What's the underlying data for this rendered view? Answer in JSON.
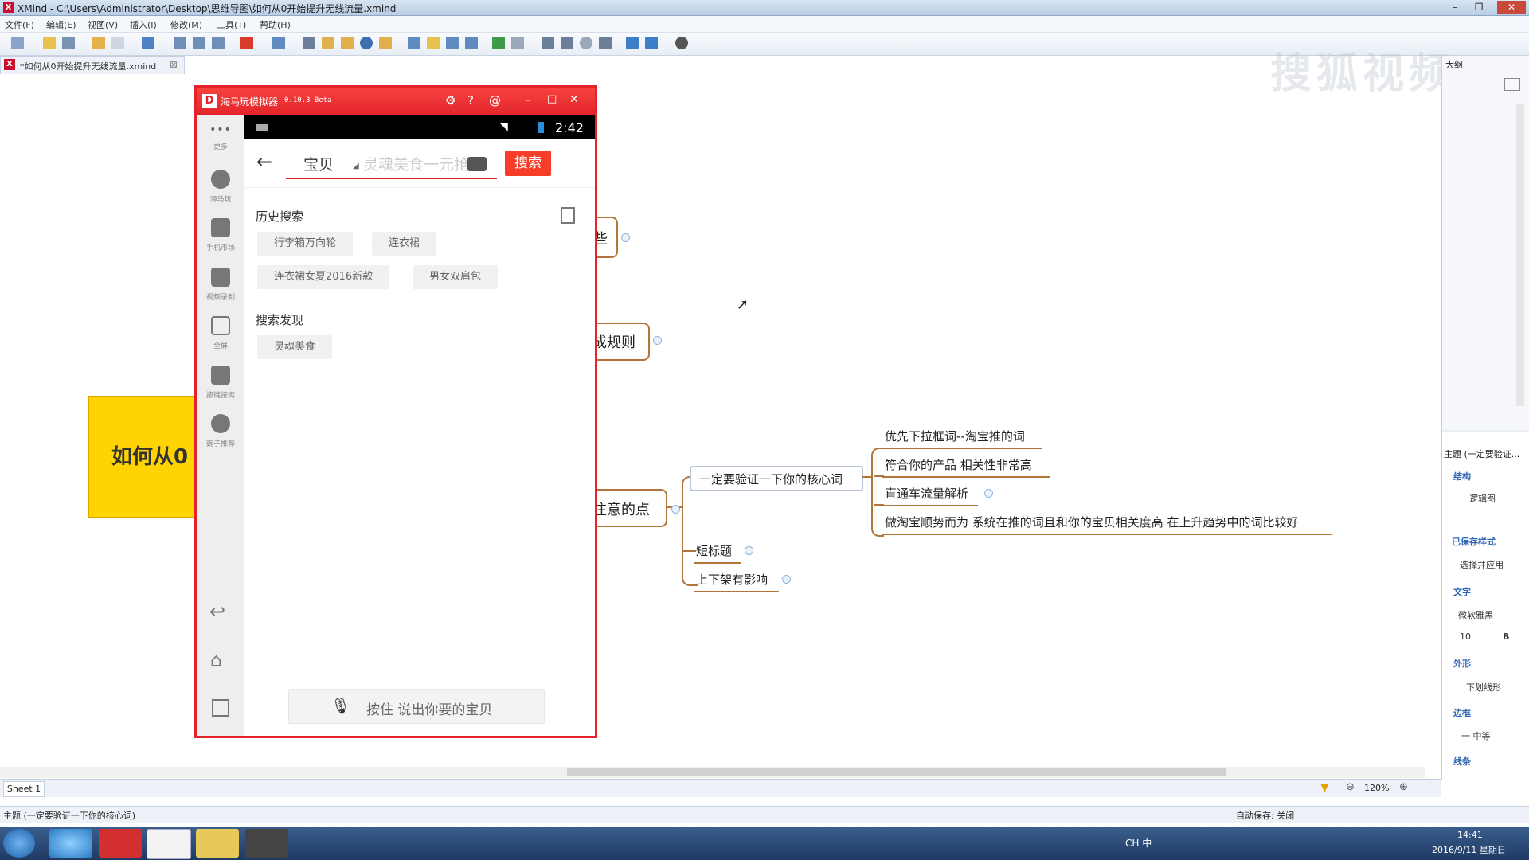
{
  "window": {
    "title": "XMind - C:\\Users\\Administrator\\Desktop\\思维导图\\如何从0开始提升无线流量.xmind",
    "app_icon": "X"
  },
  "menu": [
    "文件(F)",
    "编辑(E)",
    "视图(V)",
    "插入(I)",
    "修改(M)",
    "工具(T)",
    "帮助(H)"
  ],
  "doc_tab": {
    "label": "*如何从0开始提升无线流量.xmind",
    "close": "⊠"
  },
  "watermark": "搜狐视频",
  "mindmap": {
    "root": "如何从0",
    "branch_fragments": [
      "些",
      "成规则",
      "注意的点"
    ],
    "core_node": "一定要验证一下你的核心词",
    "core_children": [
      "优先下拉框词--淘宝推的词",
      "符合你的产品  相关性非常高",
      "直通车流量解析",
      "做淘宝顺势而为 系统在推的词且和你的宝贝相关度高 在上升趋势中的词比较好"
    ],
    "other_children": [
      "短标题",
      "上下架有影响"
    ]
  },
  "emulator": {
    "title": "海马玩模拟器",
    "version": "0.10.3 Beta",
    "title_icons": [
      "gear-icon",
      "help-icon",
      "at-icon"
    ],
    "sidebar": [
      {
        "label": "更多",
        "icon": "more-icon"
      },
      {
        "label": "海马玩",
        "icon": "haima-icon"
      },
      {
        "label": "手机市场",
        "icon": "market-icon"
      },
      {
        "label": "视频录制",
        "icon": "video-record-icon"
      },
      {
        "label": "全屏",
        "icon": "fullscreen-icon"
      },
      {
        "label": "按键按键",
        "icon": "keymap-icon"
      },
      {
        "label": "豌子推荐",
        "icon": "recommend-icon"
      }
    ],
    "status_time": "2:42",
    "search": {
      "category": "宝贝",
      "placeholder": "灵魂美食一元抢",
      "button": "搜索"
    },
    "history_title": "历史搜索",
    "history_chips": [
      "行李箱万向轮",
      "连衣裙",
      "连衣裙女夏2016新款",
      "男女双肩包"
    ],
    "discover_title": "搜索发现",
    "discover_chips": [
      "灵魂美食"
    ],
    "voice_button": "按住 说出你要的宝贝"
  },
  "right_panel": {
    "top_label": "大纲",
    "title": "主题 (一定要验证...",
    "sections": [
      {
        "heading": "结构",
        "value": "逻辑图"
      },
      {
        "heading": "已保存样式",
        "value": "选择并应用"
      },
      {
        "heading": "文字",
        "value": "微软雅黑"
      },
      {
        "heading": "外形",
        "value": "下划线形"
      },
      {
        "heading": "边框",
        "value": "一 中等"
      },
      {
        "heading": "线条",
        "value": ""
      }
    ],
    "font_size": "10",
    "bold": "B"
  },
  "sheet_tab": "Sheet 1",
  "zoom": "120%",
  "status": {
    "left": "主题 (一定要验证一下你的核心词)",
    "autosave": "自动保存: 关闭"
  },
  "taskbar": {
    "time": "14:41",
    "date": "2016/9/11 星期日",
    "tray_text": "CH 中"
  },
  "colors": {
    "accent_red": "#e2242a",
    "branch_brown": "#b2763a",
    "root_yellow": "#ffd400"
  }
}
